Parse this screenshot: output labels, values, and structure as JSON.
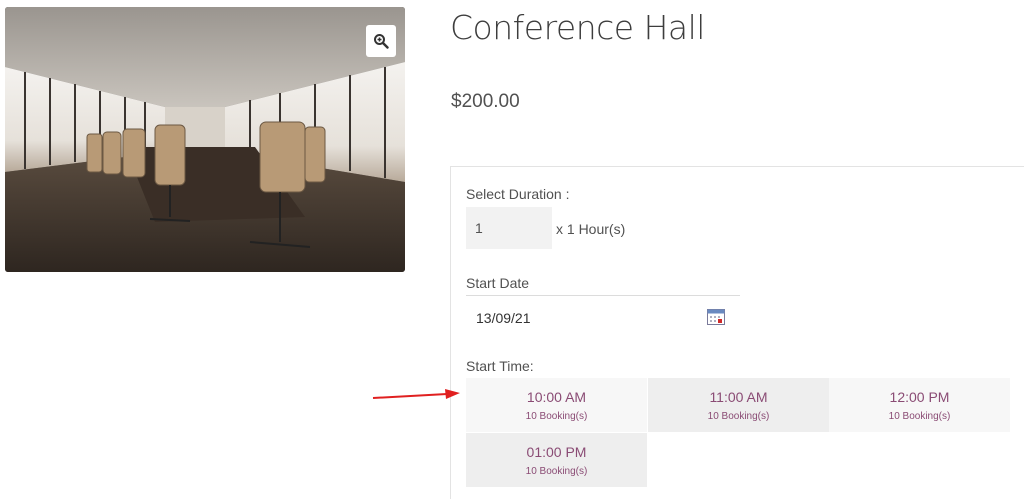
{
  "product": {
    "title": "Conference Hall",
    "price": "$200.00",
    "image_icon": "zoom-in-icon"
  },
  "booking": {
    "duration_label": "Select Duration :",
    "duration_value": "1",
    "duration_unit": "x 1 Hour(s)",
    "start_date_label": "Start Date",
    "start_date_value": "13/09/21",
    "calendar_icon": "calendar-icon",
    "start_time_label": "Start Time:",
    "slots": [
      {
        "time": "10:00 AM",
        "bookings": "10 Booking(s)"
      },
      {
        "time": "11:00 AM",
        "bookings": "10 Booking(s)"
      },
      {
        "time": "12:00 PM",
        "bookings": "10 Booking(s)"
      },
      {
        "time": "01:00 PM",
        "bookings": "10 Booking(s)"
      }
    ]
  },
  "annotation": {
    "arrow_color": "#e02020"
  },
  "colors": {
    "slot_text": "#8a4b74",
    "slot_bg_light": "#f7f7f7",
    "slot_bg_dark": "#eeeeee"
  }
}
